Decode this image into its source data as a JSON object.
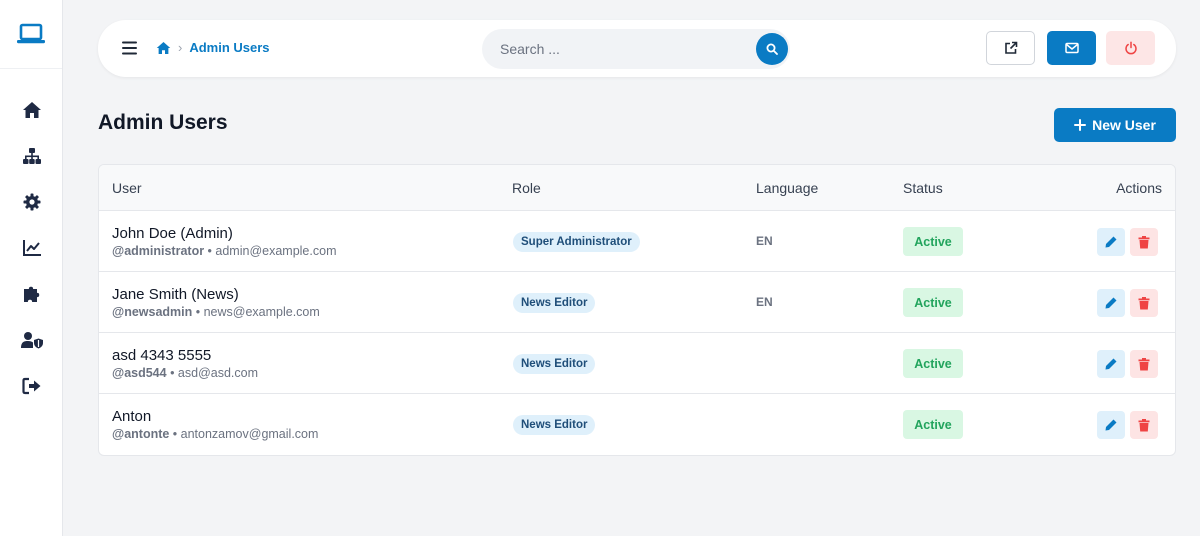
{
  "sidebar": {
    "logo_icon": "laptop-icon",
    "items": [
      {
        "name": "home",
        "icon": "home-icon"
      },
      {
        "name": "sitemap",
        "icon": "sitemap-icon"
      },
      {
        "name": "settings",
        "icon": "gear-icon"
      },
      {
        "name": "analytics",
        "icon": "chart-line-icon"
      },
      {
        "name": "plugins",
        "icon": "puzzle-icon"
      },
      {
        "name": "user-shield",
        "icon": "user-shield-icon"
      },
      {
        "name": "logout",
        "icon": "sign-out-icon"
      }
    ]
  },
  "topbar": {
    "breadcrumb": {
      "current": "Admin Users"
    },
    "search": {
      "placeholder": "Search ..."
    }
  },
  "page": {
    "title": "Admin Users",
    "new_user_label": "New User"
  },
  "table": {
    "columns": [
      "User",
      "Role",
      "Language",
      "Status",
      "Actions"
    ],
    "rows": [
      {
        "name": "John Doe (Admin)",
        "username": "@administrator",
        "email": "admin@example.com",
        "role": "Super Administrator",
        "language": "EN",
        "status": "Active"
      },
      {
        "name": "Jane Smith (News)",
        "username": "@newsadmin",
        "email": "news@example.com",
        "role": "News Editor",
        "language": "EN",
        "status": "Active"
      },
      {
        "name": "asd 4343 5555",
        "username": "@asd544",
        "email": "asd@asd.com",
        "role": "News Editor",
        "language": "",
        "status": "Active"
      },
      {
        "name": "Anton",
        "username": "@antonte",
        "email": "antonzamov@gmail.com",
        "role": "News Editor",
        "language": "",
        "status": "Active"
      }
    ]
  },
  "colors": {
    "accent": "#0a7bc4",
    "active_status_bg": "#d9f7e3",
    "active_status_text": "#22a45d",
    "danger_bg": "#fde4e4",
    "danger": "#ef4444"
  }
}
